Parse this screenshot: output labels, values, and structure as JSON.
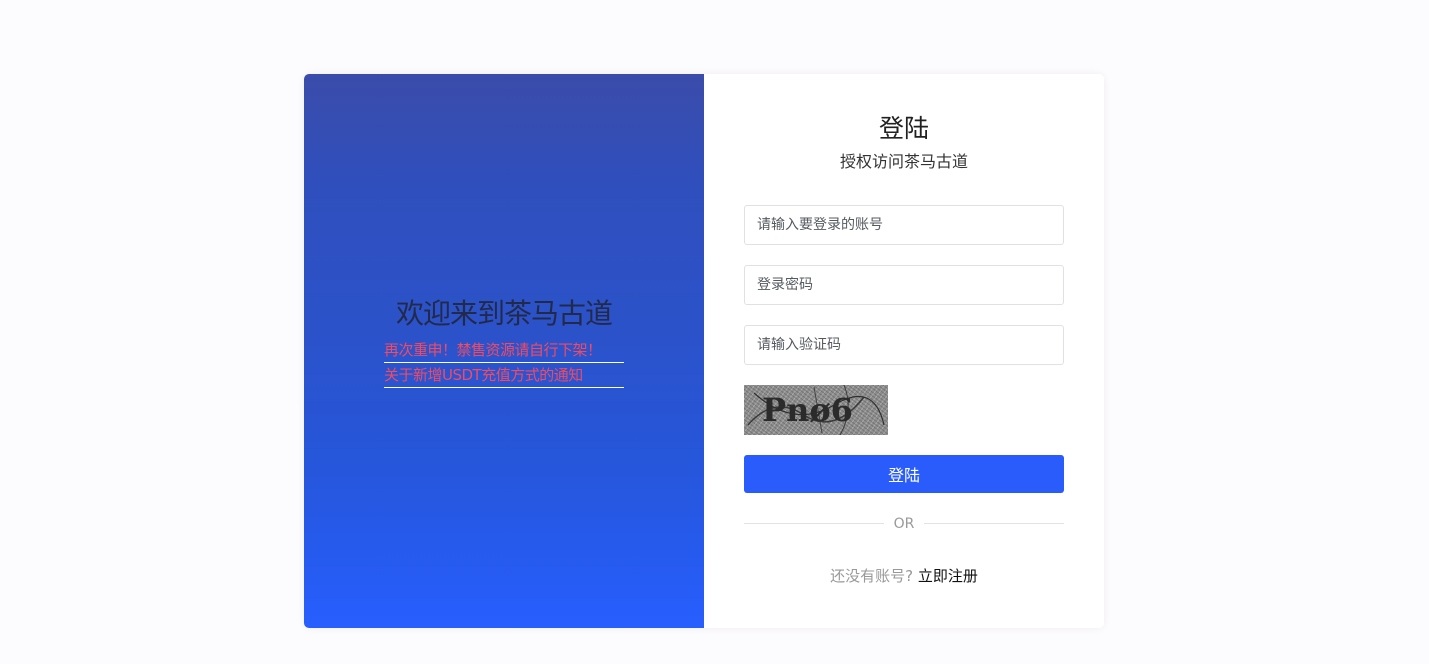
{
  "welcome": {
    "title": "欢迎来到茶马古道",
    "notices": [
      "再次重申！禁售资源请自行下架！",
      "关于新增USDT充值方式的通知"
    ]
  },
  "login": {
    "title": "登陆",
    "subtitle": "授权访问茶马古道",
    "account_placeholder": "请输入要登录的账号",
    "password_placeholder": "登录密码",
    "captcha_placeholder": "请输入验证码",
    "captcha_text": "Pnø6",
    "submit_label": "登陆",
    "divider_text": "OR",
    "register_hint": "还没有账号?",
    "register_link": "立即注册"
  },
  "colors": {
    "page_background": "#fcfbfd",
    "panel_gradient_top": "#3b4caa",
    "panel_gradient_bottom": "#275efe",
    "primary_button": "#2a5cfb",
    "notice_text": "#f24a63"
  }
}
